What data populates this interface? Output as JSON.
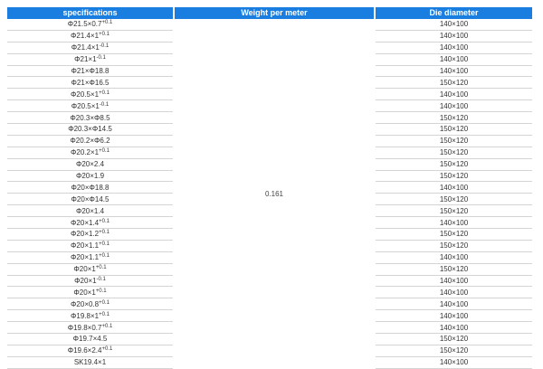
{
  "headers": [
    "specifications",
    "Weight per meter",
    "Die diameter"
  ],
  "weight_value": "0.161",
  "rows": [
    {
      "spec": "Φ21.5×0.7",
      "sup": "+0.1",
      "die": "140×100"
    },
    {
      "spec": "Φ21.4×1",
      "sup": "+0.1",
      "die": "140×100"
    },
    {
      "spec": "Φ21.4×1",
      "sup": "-0.1",
      "die": "140×100"
    },
    {
      "spec": "Φ21×1",
      "sup": "-0.1",
      "die": "140×100"
    },
    {
      "spec": "Φ21×Φ18.8",
      "sup": "",
      "die": "140×100"
    },
    {
      "spec": "Φ21×Φ16.5",
      "sup": "",
      "die": "150×120"
    },
    {
      "spec": "Φ20.5×1",
      "sup": "+0.1",
      "die": "140×100"
    },
    {
      "spec": "Φ20.5×1",
      "sup": "-0.1",
      "die": "140×100"
    },
    {
      "spec": "Φ20.3×Φ8.5",
      "sup": "",
      "die": "150×120"
    },
    {
      "spec": "Φ20.3×Φ14.5",
      "sup": "",
      "die": "150×120"
    },
    {
      "spec": "Φ20.2×Φ6.2",
      "sup": "",
      "die": "150×120"
    },
    {
      "spec": "Φ20.2×1",
      "sup": "+0.1",
      "die": "150×120"
    },
    {
      "spec": "Φ20×2.4",
      "sup": "",
      "die": "150×120"
    },
    {
      "spec": "Φ20×1.9",
      "sup": "",
      "die": "150×120"
    },
    {
      "spec": "Φ20×Φ18.8",
      "sup": "",
      "die": "140×100"
    },
    {
      "spec": "Φ20×Φ14.5",
      "sup": "",
      "die": "150×120"
    },
    {
      "spec": "Φ20×1.4",
      "sup": "",
      "die": "150×120"
    },
    {
      "spec": "Φ20×1.4",
      "sup": "+0.1",
      "die": "140×100"
    },
    {
      "spec": "Φ20×1.2",
      "sup": "+0.1",
      "die": "150×120"
    },
    {
      "spec": "Φ20×1.1",
      "sup": "+0.1",
      "die": "150×120"
    },
    {
      "spec": "Φ20×1.1",
      "sup": "+0.1",
      "die": "140×100"
    },
    {
      "spec": "Φ20×1",
      "sup": "+0.1",
      "die": "150×120"
    },
    {
      "spec": "Φ20×1",
      "sup": "-0.1",
      "die": "140×100"
    },
    {
      "spec": "Φ20×1",
      "sup": "+0.1",
      "die": "140×100"
    },
    {
      "spec": "Φ20×0.8",
      "sup": "+0.1",
      "die": "140×100"
    },
    {
      "spec": "Φ19.8×1",
      "sup": "+0.1",
      "die": "140×100"
    },
    {
      "spec": "Φ19.8×0.7",
      "sup": "+0.1",
      "die": "140×100"
    },
    {
      "spec": "Φ19.7×4.5",
      "sup": "",
      "die": "150×120"
    },
    {
      "spec": "Φ19.6×2.4",
      "sup": "+0.1",
      "die": "150×120"
    },
    {
      "spec": "SK19.4×1",
      "sup": "",
      "die": "140×100"
    }
  ],
  "colors": {
    "header_bg": "#1a7de0",
    "header_text": "#ffffff",
    "row_border": "#d4d4d4"
  }
}
